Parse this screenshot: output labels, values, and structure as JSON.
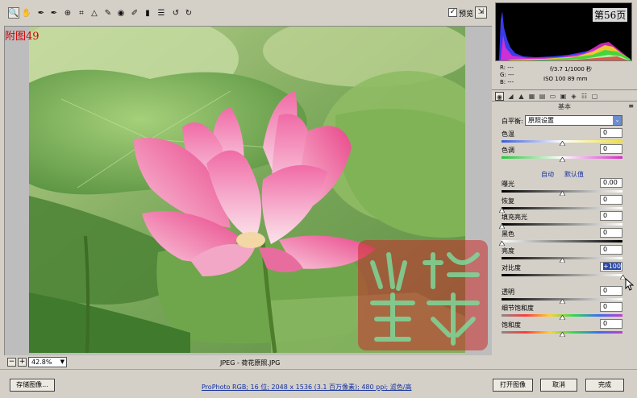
{
  "toolbar": {
    "tools": [
      "zoom-tool",
      "hand-tool",
      "white-balance-tool",
      "color-sampler-tool",
      "target-adjust-tool",
      "crop-tool",
      "straighten-tool",
      "retouch-tool",
      "red-eye-tool",
      "adjustment-brush-tool",
      "graduated-filter-tool",
      "preferences-tool",
      "rotate-left-tool",
      "rotate-right-tool"
    ],
    "preview_checked": "✓",
    "preview_label": "预览"
  },
  "preview": {
    "figure_label": "附图49",
    "zoom": "42.8%",
    "file_name": "JPEG - 荷花原照.JPG",
    "watermark": "兴洲阳光"
  },
  "histogram": {
    "page_number": "第56页"
  },
  "readout": {
    "r": "R:  ---",
    "g": "G:  ---",
    "b": "B:  ---",
    "aperture_shutter": "f/3.7   1/1000 秒",
    "iso_focal": "ISO 100   89 mm"
  },
  "panel": {
    "section_title": "基本",
    "section_menu": "≡",
    "white_balance_label": "白平衡:",
    "white_balance_value": "原照设置",
    "auto_label": "自动",
    "default_label": "默认值",
    "sliders": [
      {
        "name": "temperature",
        "label": "色温",
        "value": "0",
        "level": 0.5
      },
      {
        "name": "tint",
        "label": "色调",
        "value": "0",
        "level": 0.5
      },
      {
        "name": "exposure",
        "label": "曝光",
        "value": "0.00",
        "level": 0.5
      },
      {
        "name": "recovery",
        "label": "恢复",
        "value": "0",
        "level": 0.0
      },
      {
        "name": "fill-light",
        "label": "填充亮光",
        "value": "0",
        "level": 0.0
      },
      {
        "name": "blacks",
        "label": "黑色",
        "value": "0",
        "level": 0.0
      },
      {
        "name": "brightness",
        "label": "亮度",
        "value": "0",
        "level": 0.5
      },
      {
        "name": "contrast",
        "label": "对比度",
        "value": "+100",
        "level": 1.0
      },
      {
        "name": "clarity",
        "label": "透明",
        "value": "0",
        "level": 0.5
      },
      {
        "name": "vibrance",
        "label": "细节饱和度",
        "value": "0",
        "level": 0.5
      },
      {
        "name": "saturation",
        "label": "饱和度",
        "value": "0",
        "level": 0.5
      }
    ]
  },
  "bottom": {
    "save_label": "存储图像...",
    "workflow_text": "ProPhoto RGB; 16 位; 2048 x 1536 (3.1 百万像素); 480 ppi; 滤色/高",
    "open_label": "打开图像",
    "cancel_label": "取消",
    "done_label": "完成"
  }
}
